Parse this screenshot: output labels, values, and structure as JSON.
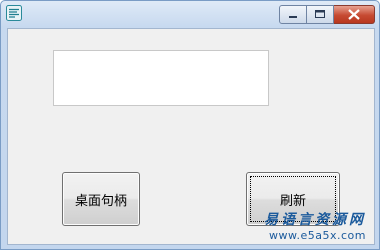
{
  "window": {
    "title": "",
    "icon": "app-window-icon",
    "caption_buttons": [
      "minimize",
      "maximize",
      "close"
    ],
    "colors": {
      "frame": "#c3d6ee",
      "client": "#f0f0f0",
      "close": "#c64a32"
    }
  },
  "main": {
    "textbox": {
      "value": ""
    },
    "handle_button": {
      "label": "桌面句柄"
    },
    "refresh_button": {
      "label": "刷新"
    }
  },
  "watermark": {
    "title": "易语言资源网",
    "url": "www.e5a5x.com"
  }
}
